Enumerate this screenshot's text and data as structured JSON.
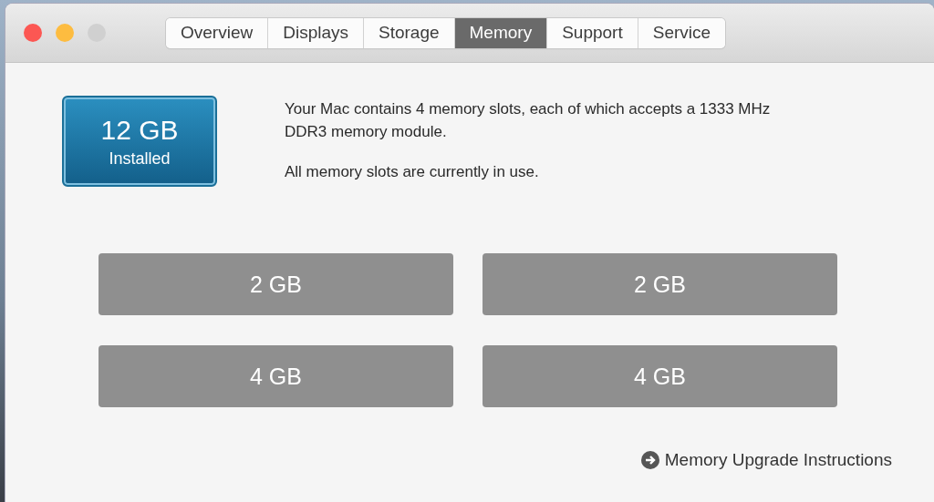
{
  "window": {
    "controls": [
      {
        "kind": "close"
      },
      {
        "kind": "minimize"
      },
      {
        "kind": "zoom"
      }
    ]
  },
  "tabs": [
    {
      "label": "Overview",
      "selected": false
    },
    {
      "label": "Displays",
      "selected": false
    },
    {
      "label": "Storage",
      "selected": false
    },
    {
      "label": "Memory",
      "selected": true
    },
    {
      "label": "Support",
      "selected": false
    },
    {
      "label": "Service",
      "selected": false
    }
  ],
  "installed": {
    "amount": "12 GB",
    "label": "Installed"
  },
  "description": [
    "Your Mac contains 4 memory slots, each of which accepts a 1333 MHz DDR3 memory module.",
    "All memory slots are currently in use."
  ],
  "slots": [
    {
      "label": "2 GB"
    },
    {
      "label": "2 GB"
    },
    {
      "label": "4 GB"
    },
    {
      "label": "4 GB"
    }
  ],
  "link": {
    "label": "Memory Upgrade Instructions"
  }
}
